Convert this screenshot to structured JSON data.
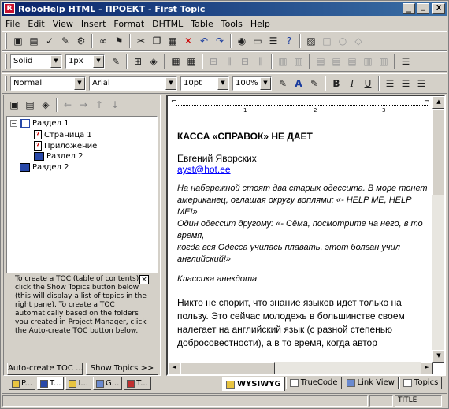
{
  "window": {
    "title": "RoboHelp HTML - ПРОЕКТ - First Topic",
    "minimize": "_",
    "maximize": "□",
    "close": "X"
  },
  "menu": [
    "File",
    "Edit",
    "View",
    "Insert",
    "Format",
    "DHTML",
    "Table",
    "Tools",
    "Help"
  ],
  "format_bar": {
    "border_style": "Solid",
    "border_width": "1px",
    "paragraph_style": "Normal",
    "font": "Arial",
    "size": "10pt",
    "zoom": "100%",
    "bold": "B",
    "italic": "I",
    "underline": "U"
  },
  "toc": {
    "items": [
      {
        "label": "Раздел 1",
        "type": "book-open",
        "level": 0
      },
      {
        "label": "Страница 1",
        "type": "page",
        "level": 1
      },
      {
        "label": "Приложение",
        "type": "page",
        "level": 1
      },
      {
        "label": "Раздел 2",
        "type": "book",
        "level": 1
      },
      {
        "label": "Раздел 2",
        "type": "book",
        "level": 0
      }
    ],
    "help_text": "To create a TOC (table of contents), click the Show Topics button below (this will display a list of topics in the right pane). To create a TOC automatically based on the folders you created in Project Manager, click the Auto-create TOC button below.",
    "auto_create_btn": "Auto-create TOC ...",
    "show_topics_btn": "Show Topics >>"
  },
  "left_tabs": [
    "P...",
    "T...",
    "I...",
    "G...",
    "T..."
  ],
  "document": {
    "heading": "КАССА «СПРАВОК» НЕ ДАЕТ",
    "author": "Евгений Яворских",
    "email": "ayst@hot.ee",
    "joke_lines": [
      "На набережной стоят два старых одессита. В море тонет",
      "американец, оглашая округу воплями: «- HELP ME, HELP ME!»",
      "Один одессит другому: «- Сёма, посмотрите на него, в то время,",
      "когда вся Одесса училась плавать, этот болван учил английский!»"
    ],
    "classic": "Классика анекдота",
    "para": "Никто не спорит, что знание языков идет только на пользу. Это сейчас молодежь в большинстве своем налегает на английский язык (с разной степенью добросовестности), а в то время, когда автор"
  },
  "ruler_marks": [
    "1",
    "2",
    "3"
  ],
  "bottom_tabs": [
    "WYSIWYG",
    "TrueCode",
    "Link View",
    "Topics"
  ],
  "status": {
    "title": "TITLE"
  }
}
